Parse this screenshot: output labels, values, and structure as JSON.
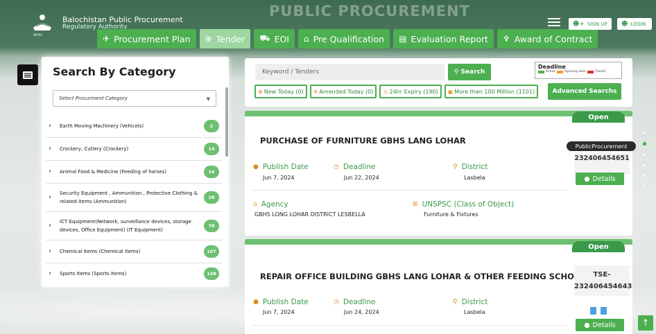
{
  "header": {
    "org_name": "Balochistan Public Procurement",
    "org_sub": "Regulatory Authority",
    "logo_text": "BPPRA",
    "big_title": "PUBLIC PROCUREMENT",
    "signup": "SIGN UP",
    "login": "LOGIN",
    "nav": [
      {
        "label": "Procurement Plan",
        "icon": "rocket-icon"
      },
      {
        "label": "Tender",
        "icon": "globe-icon"
      },
      {
        "label": "EOI",
        "icon": "car-icon"
      },
      {
        "label": "Pre Qualification",
        "icon": "graduation-icon"
      },
      {
        "label": "Evaluation Report",
        "icon": "file-icon"
      },
      {
        "label": "Award of Contract",
        "icon": "trophy-icon"
      }
    ]
  },
  "category_panel": {
    "title": "Search By Category",
    "select_placeholder": "Select Procurment Category",
    "items": [
      {
        "label": "Earth Moving Machinery (Vehicels)",
        "count": "2"
      },
      {
        "label": "Crockery, Cutlery (Crockery)",
        "count": "14"
      },
      {
        "label": "Animal Food & Medicine (Feeding of horses)",
        "count": "16"
      },
      {
        "label": "Security Equipment , Ammunition , Protective Clothing & related items (Ammunition)",
        "count": "28"
      },
      {
        "label": "ICT Equipment(Network, surveillance devices, storage devices, Office Equipment) (IT Equipment)",
        "count": "78"
      },
      {
        "label": "Chemical Items (Chemical Items)",
        "count": "107"
      },
      {
        "label": "Sports Items (Sports Items)",
        "count": "148"
      }
    ]
  },
  "search": {
    "placeholder": "Keyword / Tenders",
    "button": "Search",
    "legend_title": "Deadline",
    "legend": [
      {
        "label": "Active",
        "color": "#4caf50"
      },
      {
        "label": "Opening soon",
        "color": "#f0a020"
      },
      {
        "label": "Closed",
        "color": "#d9302c"
      }
    ],
    "filters": [
      "New Today (0)",
      "Amended Today (0)",
      "24hr Expiry (190)",
      "More then 100 Million (1101)"
    ],
    "advanced": "Advanced Searchs"
  },
  "labels": {
    "publish": "Publish Date",
    "deadline": "Deadline",
    "district": "District",
    "agency": "Agency",
    "unspsc": "UNSPSC (Class of Object)",
    "details": "Details",
    "tooltip": "PublicProcurement"
  },
  "tenders": [
    {
      "status": "Open",
      "title": "PURCHASE OF FURNITURE GBHS LANG LOHAR",
      "publish_date": "Jun 7, 2024",
      "deadline": "Jun 22, 2024",
      "district": "Lasbela",
      "agency": "GBHS LONG LOHAR DISTRICT LESBELLA",
      "unspsc": "Furniture & Fixtures",
      "tse": "232406454651"
    },
    {
      "status": "Open",
      "title": "REPAIR OFFICE BUILDING GBHS LANG LOHAR & OTHER FEEDING SCHOOL",
      "publish_date": "Jun 7, 2024",
      "deadline": "Jun 24, 2024",
      "district": "Lasbela",
      "agency": "",
      "unspsc": "",
      "tse": "TSE-232406454643"
    }
  ]
}
